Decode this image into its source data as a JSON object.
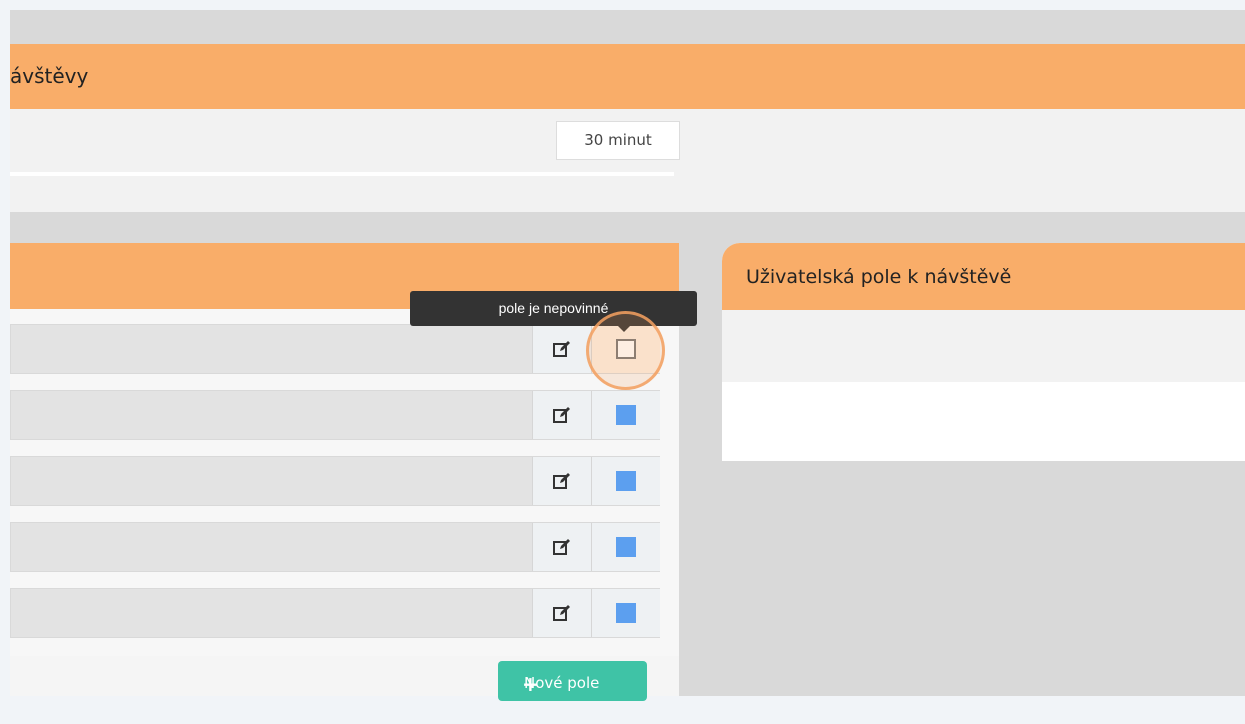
{
  "top_panel": {
    "title": "ávštěvy",
    "duration_value": "30 minut"
  },
  "left_panel": {
    "rows": [
      {
        "edit_icon": "edit-icon",
        "required": false
      },
      {
        "edit_icon": "edit-icon",
        "required": true
      },
      {
        "edit_icon": "edit-icon",
        "required": true
      },
      {
        "edit_icon": "edit-icon",
        "required": true
      },
      {
        "edit_icon": "edit-icon",
        "required": true
      }
    ],
    "new_field_button": "Nové pole",
    "new_field_icon": "plus-icon"
  },
  "right_panel": {
    "title": "Uživatelská pole k návštěvě"
  },
  "tooltip": {
    "text": "pole je nepovinné"
  },
  "colors": {
    "header_orange": "#f9ad69",
    "checkbox_blue": "#5c9fef",
    "button_green": "#3fc3a6",
    "highlight_ring": "#f3a060"
  }
}
